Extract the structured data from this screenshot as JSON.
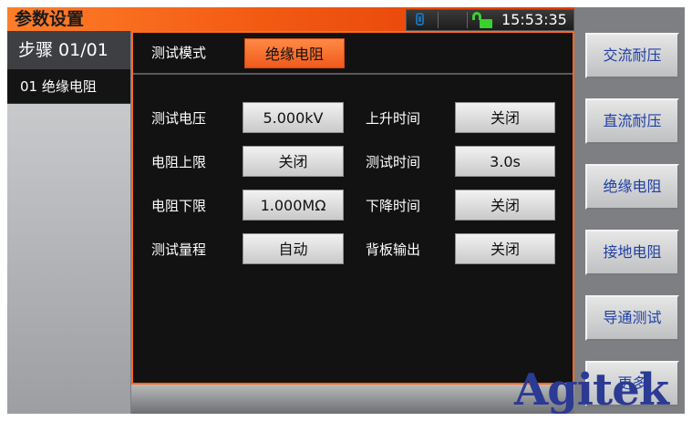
{
  "titlebar": {
    "title": "参数设置",
    "time": "15:53:35"
  },
  "step": {
    "header": "步骤 01/01",
    "items": [
      "01 绝缘电阻"
    ]
  },
  "mode": {
    "label": "测试模式",
    "value": "绝缘电阻"
  },
  "params": [
    {
      "label": "测试电压",
      "value": "5.000kV"
    },
    {
      "label": "上升时间",
      "value": "关闭"
    },
    {
      "label": "电阻上限",
      "value": "关闭"
    },
    {
      "label": "测试时间",
      "value": "3.0s"
    },
    {
      "label": "电阻下限",
      "value": "1.000MΩ"
    },
    {
      "label": "下降时间",
      "value": "关闭"
    },
    {
      "label": "测试量程",
      "value": "自动"
    },
    {
      "label": "背板输出",
      "value": "关闭"
    }
  ],
  "softkeys": [
    "交流耐压",
    "直流耐压",
    "绝缘电阻",
    "接地电阻",
    "导通测试",
    "更多"
  ],
  "watermark": "Agitek",
  "icons": {
    "usb": "usb-drive-icon",
    "lock": "unlocked-padlock-icon"
  },
  "colors": {
    "accent": "#f25a12",
    "softkey_text": "#1f3fa3",
    "lock": "#39d12b",
    "usb": "#1a6fb0"
  }
}
